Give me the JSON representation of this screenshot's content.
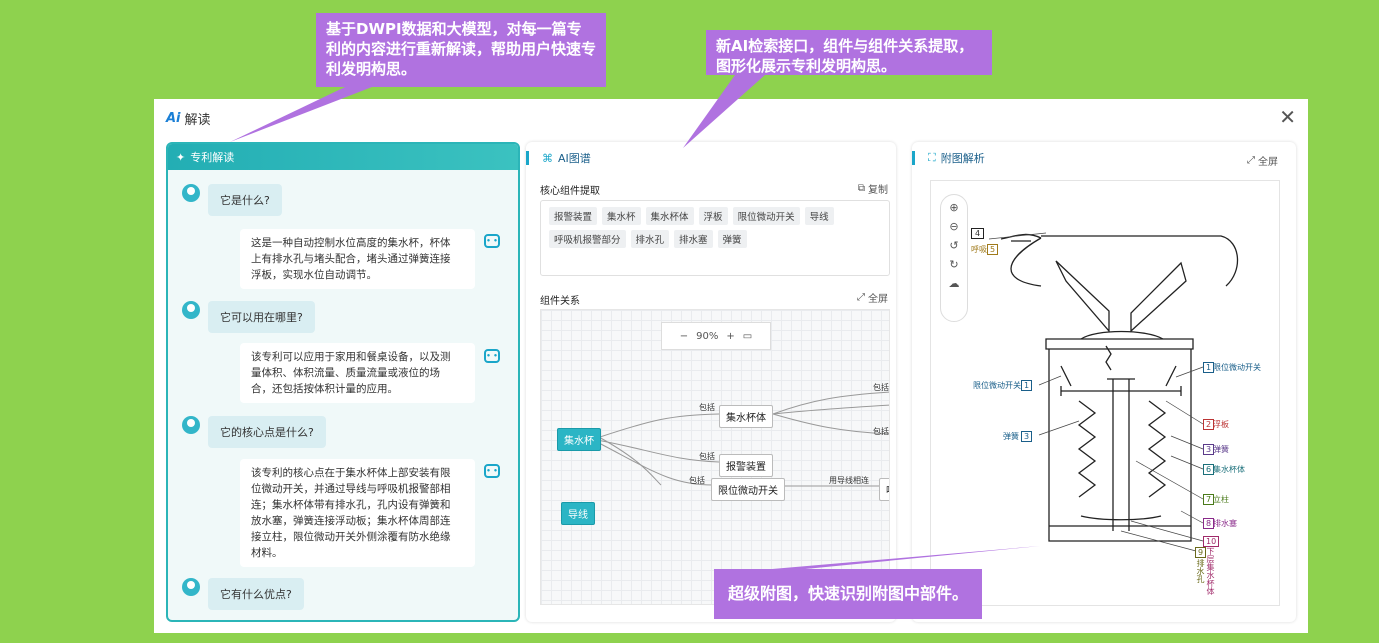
{
  "callouts": {
    "top_left": "基于DWPI数据和大模型，对每一篇专利的内容进行重新解读，帮助用户快速专利发明构思。",
    "top_right": "新AI检索接口，组件与组件关系提取，图形化展示专利发明构思。",
    "bottom": "超级附图，快速识别附图中部件。"
  },
  "modal": {
    "logo": "Ai",
    "title": "解读",
    "close": "✕"
  },
  "left_panel": {
    "title": "专利解读",
    "chat": [
      {
        "q": "它是什么?",
        "a": [
          "这是一种自动控制水位高度的集水杯，杯体",
          "上有排水孔与堵头配合，堵头通过弹簧连接",
          "浮板，实现水位自动调节。"
        ]
      },
      {
        "q": "它可以用在哪里?",
        "a": [
          "该专利可以应用于家用和餐桌设备，以及测",
          "量体积、体积流量、质量流量或液位的场",
          "合，还包括按体积计量的应用。"
        ]
      },
      {
        "q": "它的核心点是什么?",
        "a": [
          "该专利的核心点在于集水杯体上部安装有限",
          "位微动开关，并通过导线与呼吸机报警部相",
          "连；集水杯体带有排水孔，孔内设有弹簧和",
          "放水塞，弹簧连接浮动板；集水杯体周部连",
          "接立柱，限位微动开关外侧涂覆有防水绝缘",
          "材料。"
        ]
      },
      {
        "q": "它有什么优点?"
      }
    ]
  },
  "mid_panel": {
    "title": "AI图谱",
    "core_title": "核心组件提取",
    "copy_label": "复制",
    "tags": [
      "报警装置",
      "集水杯",
      "集水杯体",
      "浮板",
      "限位微动开关",
      "导线",
      "呼吸机报警部分",
      "排水孔",
      "排水塞",
      "弹簧"
    ],
    "relation_title": "组件关系",
    "fullscreen": "全屏",
    "zoom": {
      "minus": "−",
      "value": "90%",
      "plus": "+"
    },
    "graph": {
      "root": "集水杯",
      "isolated": "导线",
      "nodes": [
        "集水杯体",
        "报警装置",
        "限位微动开关",
        "呼"
      ],
      "edge_labels": [
        "包括",
        "包括",
        "包括",
        "包括",
        "包括",
        "用导线相连"
      ]
    }
  },
  "right_panel": {
    "title": "附图解析",
    "fullscreen": "全屏",
    "figure_labels": {
      "n4": "4",
      "n4_text": "呼吸",
      "n5": "5",
      "limit_switch_l": "限位微动开关",
      "n1_l": "1",
      "spring_l": "弹簧",
      "n3_l": "3",
      "limit_switch_r": "限位微动开关",
      "n1_r": "1",
      "float": "浮板",
      "n2": "2",
      "spring_r": "弹簧",
      "n3_r": "3",
      "cup_body": "集水杯体",
      "n6": "6",
      "pillar": "立柱",
      "n7": "7",
      "drain_plug": "排水塞",
      "n8": "8",
      "bottom_cup": "下层集水杯体",
      "n10": "10",
      "drain_hole": "排水孔",
      "n9": "9"
    }
  },
  "colors": {
    "accent": "#2bb5b8",
    "callout": "#b072e0",
    "background": "#8ed24e"
  }
}
